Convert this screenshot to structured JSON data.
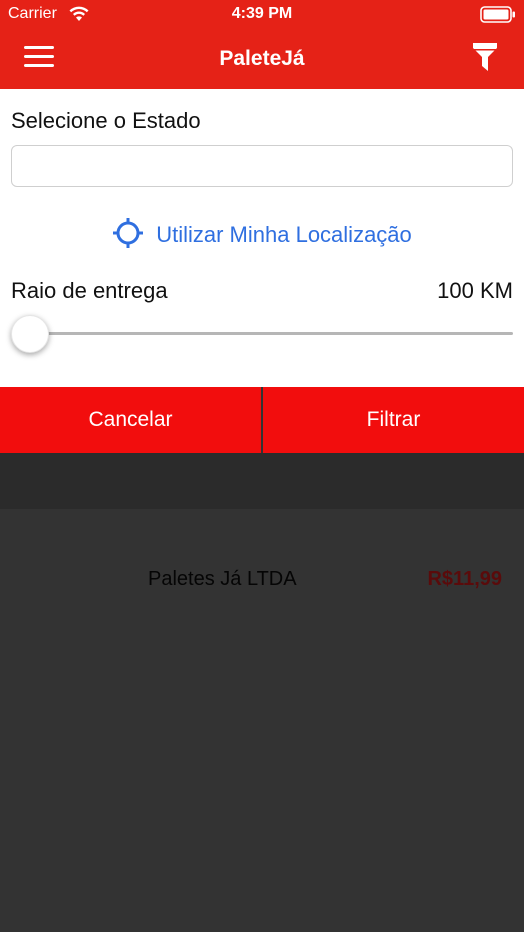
{
  "status_bar": {
    "carrier": "Carrier",
    "time": "4:39 PM"
  },
  "nav": {
    "title": "PaleteJá",
    "menu_icon": "hamburger-icon",
    "filter_icon": "funnel-icon"
  },
  "filter_panel": {
    "state_label": "Selecione o Estado",
    "state_value": "",
    "location_label": "Utilizar Minha Localização",
    "radius_label": "Raio de entrega",
    "radius_value": "100 KM",
    "slider_fraction": 0.0
  },
  "buttons": {
    "cancel": "Cancelar",
    "filter": "Filtrar"
  },
  "results": [
    {
      "name": "Paletes Já LTDA",
      "price": "R$11,99"
    }
  ],
  "colors": {
    "brand_red": "#e52217",
    "button_red": "#f20d0d",
    "link_blue": "#2f6fe0",
    "overlay": "#333333",
    "price": "#5a0b0b"
  }
}
